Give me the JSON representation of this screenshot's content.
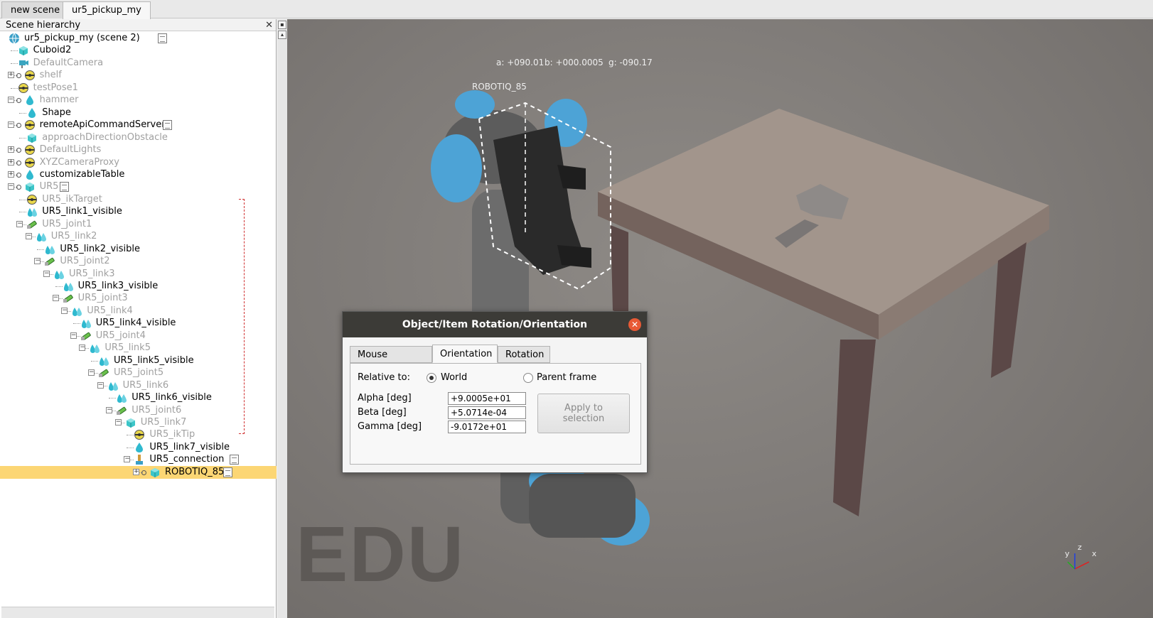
{
  "tabs": [
    {
      "label": "new scene",
      "active": false
    },
    {
      "label": "ur5_pickup_my",
      "active": true
    }
  ],
  "hierarchy": {
    "title": "Scene hierarchy",
    "close_glyph": "✕",
    "items": [
      {
        "label": "ur5_pickup_my  (scene 2)",
        "icon": "globe-icon",
        "dim": false,
        "script": true
      },
      {
        "label": "Cuboid2",
        "icon": "cube-icon",
        "dim": false
      },
      {
        "label": "DefaultCamera",
        "icon": "camera-icon",
        "dim": true
      },
      {
        "label": "shelf",
        "icon": "dummy-icon",
        "dim": true
      },
      {
        "label": "testPose1",
        "icon": "dummy-icon",
        "dim": true
      },
      {
        "label": "hammer",
        "icon": "shape-icon",
        "dim": true
      },
      {
        "label": "Shape",
        "icon": "shape-icon",
        "dim": false
      },
      {
        "label": "remoteApiCommandServer",
        "icon": "dummy-icon",
        "dim": false,
        "script": true
      },
      {
        "label": "approachDirectionObstacle",
        "icon": "cube-icon",
        "dim": true
      },
      {
        "label": "DefaultLights",
        "icon": "dummy-icon",
        "dim": true
      },
      {
        "label": "XYZCameraProxy",
        "icon": "dummy-icon",
        "dim": true
      },
      {
        "label": "customizableTable",
        "icon": "shape-icon",
        "dim": false
      },
      {
        "label": "UR5",
        "icon": "cube-icon",
        "dim": true,
        "script": true
      },
      {
        "label": "UR5_ikTarget",
        "icon": "dummy-icon",
        "dim": true
      },
      {
        "label": "UR5_link1_visible",
        "icon": "multishape-icon",
        "dim": false
      },
      {
        "label": "UR5_joint1",
        "icon": "joint-icon",
        "dim": true
      },
      {
        "label": "UR5_link2",
        "icon": "multishape-icon",
        "dim": true
      },
      {
        "label": "UR5_link2_visible",
        "icon": "multishape-icon",
        "dim": false
      },
      {
        "label": "UR5_joint2",
        "icon": "joint-icon",
        "dim": true
      },
      {
        "label": "UR5_link3",
        "icon": "multishape-icon",
        "dim": true
      },
      {
        "label": "UR5_link3_visible",
        "icon": "multishape-icon",
        "dim": false
      },
      {
        "label": "UR5_joint3",
        "icon": "joint-icon",
        "dim": true
      },
      {
        "label": "UR5_link4",
        "icon": "multishape-icon",
        "dim": true
      },
      {
        "label": "UR5_link4_visible",
        "icon": "multishape-icon",
        "dim": false
      },
      {
        "label": "UR5_joint4",
        "icon": "joint-icon",
        "dim": true
      },
      {
        "label": "UR5_link5",
        "icon": "multishape-icon",
        "dim": true
      },
      {
        "label": "UR5_link5_visible",
        "icon": "multishape-icon",
        "dim": false
      },
      {
        "label": "UR5_joint5",
        "icon": "joint-icon",
        "dim": true
      },
      {
        "label": "UR5_link6",
        "icon": "multishape-icon",
        "dim": true
      },
      {
        "label": "UR5_link6_visible",
        "icon": "multishape-icon",
        "dim": false
      },
      {
        "label": "UR5_joint6",
        "icon": "joint-icon",
        "dim": true
      },
      {
        "label": "UR5_link7",
        "icon": "cube-icon",
        "dim": true
      },
      {
        "label": "UR5_ikTip",
        "icon": "dummy-icon",
        "dim": true
      },
      {
        "label": "UR5_link7_visible",
        "icon": "shape-icon",
        "dim": false
      },
      {
        "label": "UR5_connection",
        "icon": "force-sensor-icon",
        "dim": false,
        "script": true
      },
      {
        "label": "ROBOTIQ_85",
        "icon": "cube-icon",
        "dim": false,
        "script": true,
        "selected": true
      }
    ]
  },
  "viewport": {
    "orientation_readout": {
      "a": "a: +090.01",
      "b": "b: +000.0005",
      "g": "g: -090.17"
    },
    "selected_label": "ROBOTIQ_85",
    "watermark": "EDU",
    "axes": {
      "x": "x",
      "y": "y",
      "z": "z"
    }
  },
  "dialog": {
    "title": "Object/Item Rotation/Orientation",
    "close_glyph": "✕",
    "tabs": [
      "Mouse Rotation",
      "Orientation",
      "Rotation"
    ],
    "active_tab": "Orientation",
    "relative_to_label": "Relative to:",
    "option_world": "World",
    "option_parent": "Parent frame",
    "world_selected": true,
    "alpha_label": "Alpha [deg]",
    "beta_label": "Beta [deg]",
    "gamma_label": "Gamma [deg]",
    "alpha_value": "+9.0005e+01",
    "beta_value": "+5.0714e-04",
    "gamma_value": "-9.0172e+01",
    "apply_label_1": "Apply to",
    "apply_label_2": "selection"
  },
  "colors": {
    "selection": "#fcd674",
    "dialog_title_bg": "#3c3b37",
    "close_button": "#e85a35",
    "robot_blue": "#4da3d6",
    "table_top": "#a2958c",
    "table_legs": "#5b4847"
  }
}
